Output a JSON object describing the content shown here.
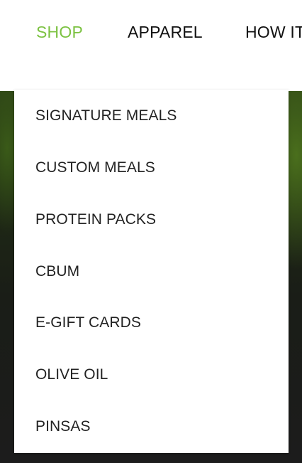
{
  "nav": {
    "items": [
      {
        "label": "SHOP",
        "active": true
      },
      {
        "label": "APPAREL",
        "active": false
      },
      {
        "label": "HOW IT",
        "active": false
      }
    ],
    "active_color": "#7cc242"
  },
  "shop_menu": {
    "items": [
      {
        "label": "SIGNATURE MEALS"
      },
      {
        "label": "CUSTOM MEALS"
      },
      {
        "label": "PROTEIN PACKS"
      },
      {
        "label": "CBUM"
      },
      {
        "label": "E-GIFT CARDS"
      },
      {
        "label": "OLIVE OIL"
      },
      {
        "label": "PINSAS"
      }
    ]
  }
}
